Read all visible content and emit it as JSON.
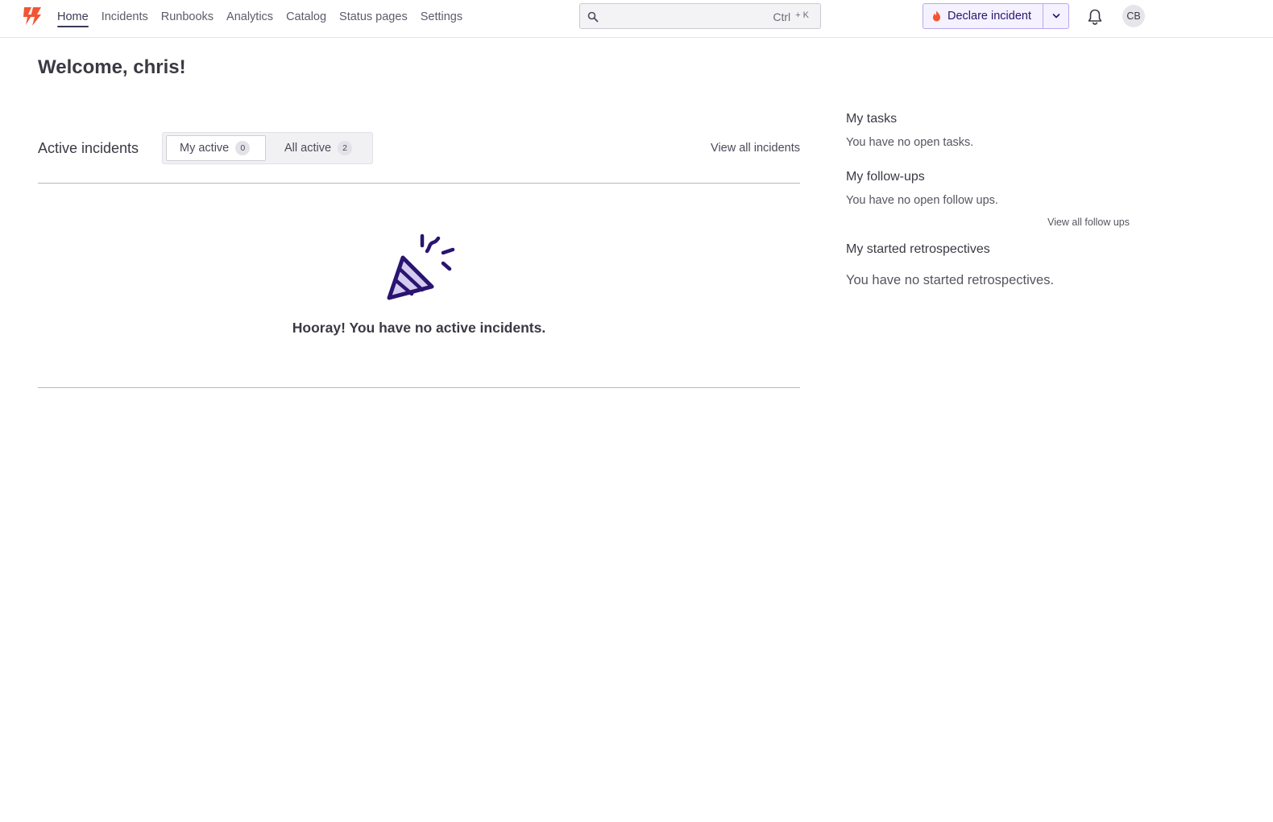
{
  "nav": {
    "items": [
      {
        "label": "Home",
        "active": true
      },
      {
        "label": "Incidents"
      },
      {
        "label": "Runbooks"
      },
      {
        "label": "Analytics"
      },
      {
        "label": "Catalog"
      },
      {
        "label": "Status pages"
      },
      {
        "label": "Settings"
      }
    ]
  },
  "search": {
    "value": "",
    "placeholder": "",
    "shortcut_key": "Ctrl",
    "shortcut_combo": "+ K"
  },
  "declare": {
    "label": "Declare incident"
  },
  "user": {
    "initials": "CB"
  },
  "welcome": {
    "title": "Welcome, chris!"
  },
  "incidents": {
    "title": "Active incidents",
    "tabs": [
      {
        "label": "My active",
        "count": "0"
      },
      {
        "label": "All active",
        "count": "2"
      }
    ],
    "view_all": "View all incidents",
    "empty_message": "Hooray! You have no active incidents."
  },
  "side": {
    "tasks": {
      "title": "My tasks",
      "text": "You have no open tasks."
    },
    "followups": {
      "title": "My follow-ups",
      "text": "You have no open follow ups.",
      "link": "View all follow ups"
    },
    "retros": {
      "title": "My started retrospectives",
      "text": "You have no started retrospectives."
    }
  },
  "colors": {
    "brand": "#f25533",
    "accent": "#2a1470",
    "accent_light": "#d4cbf0"
  }
}
